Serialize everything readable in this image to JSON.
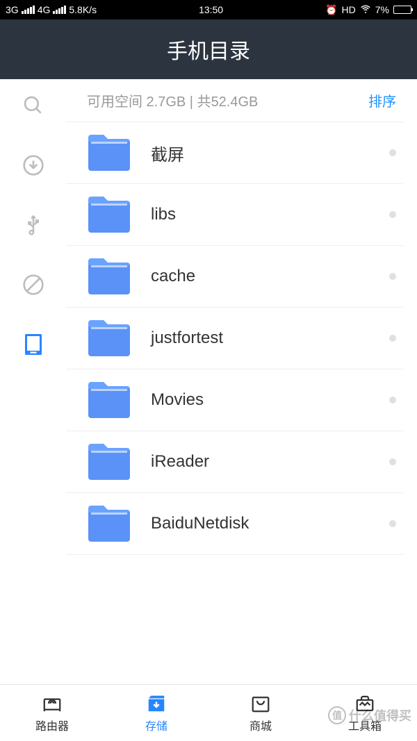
{
  "status": {
    "net1": "3G",
    "net2": "4G",
    "speed": "5.8K/s",
    "time": "13:50",
    "hd": "HD",
    "battery_pct": "7%"
  },
  "header": {
    "title": "手机目录"
  },
  "info": {
    "storage": "可用空间 2.7GB | 共52.4GB",
    "sort": "排序"
  },
  "folders": [
    {
      "name": "截屏"
    },
    {
      "name": "libs"
    },
    {
      "name": "cache"
    },
    {
      "name": "justfortest"
    },
    {
      "name": "Movies"
    },
    {
      "name": "iReader"
    },
    {
      "name": "BaiduNetdisk"
    }
  ],
  "bottomNav": {
    "router": "路由器",
    "storage": "存储",
    "shop": "商城",
    "tools": "工具箱"
  },
  "watermark": {
    "badge": "值",
    "text": "什么值得买"
  }
}
